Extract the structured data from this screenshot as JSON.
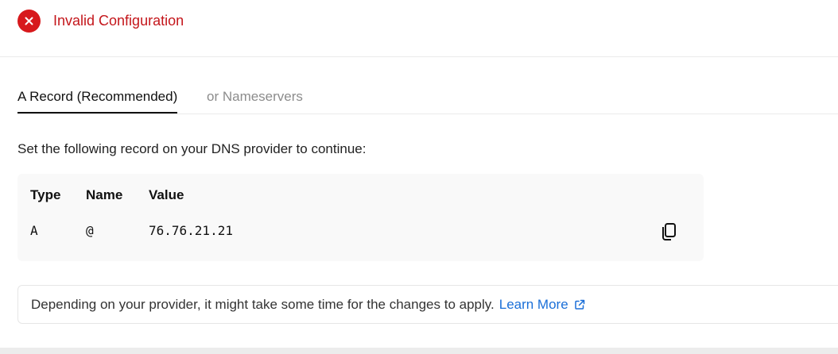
{
  "status": {
    "icon": "error-icon",
    "text": "Invalid Configuration",
    "color": "#c4161b"
  },
  "tabs": [
    {
      "label": "A Record (Recommended)",
      "active": true
    },
    {
      "label": "or Nameservers",
      "active": false
    }
  ],
  "instruction": "Set the following record on your DNS provider to continue:",
  "record_table": {
    "headers": {
      "type": "Type",
      "name": "Name",
      "value": "Value"
    },
    "row": {
      "type": "A",
      "name": "@",
      "value": "76.76.21.21"
    },
    "copy_icon": "copy-icon"
  },
  "notice": {
    "text": "Depending on your provider, it might take some time for the changes to apply.",
    "link_label": "Learn More",
    "link_icon": "external-link-icon",
    "link_color": "#1a6fd8"
  }
}
